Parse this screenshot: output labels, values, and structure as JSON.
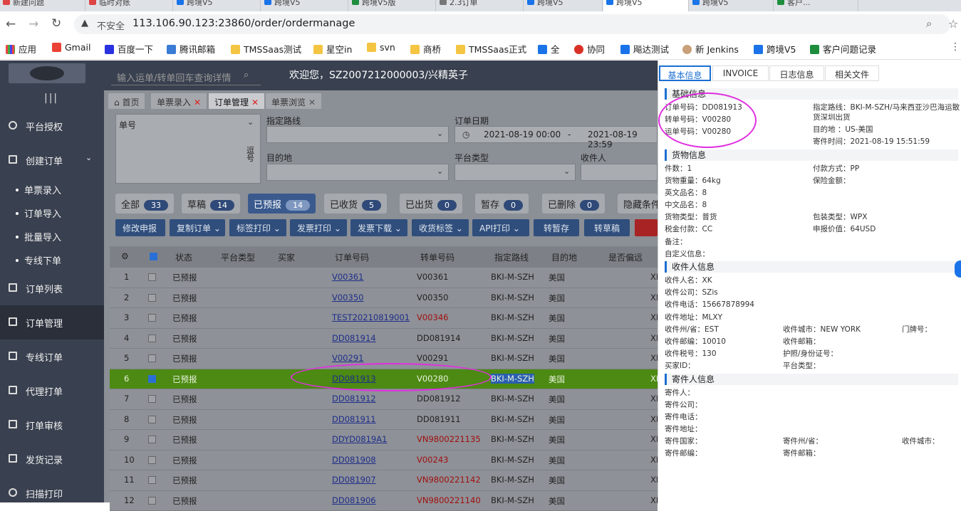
{
  "browser": {
    "tabs": [
      "新建问题",
      "临时对账",
      "跨境V5",
      "跨境V5",
      "跨境V5版",
      "2.3订单",
      "跨境V5",
      "跨境V5",
      "跨境V5",
      "客户..."
    ],
    "security": "不安全",
    "url": "113.106.90.123:23860/order/ordermanage",
    "bookmarks": [
      "应用",
      "Gmail",
      "百度一下",
      "腾讯邮箱",
      "TMSSaas测试",
      "星空in",
      "svn",
      "商桥",
      "TMSSaas正式",
      "全",
      "协同",
      "飚达测试",
      "新 Jenkins",
      "跨境V5",
      "客户问题记录"
    ]
  },
  "header": {
    "search_placeholder": "输入运单/转单回车查询详情",
    "welcome": "欢迎您，SZ2007212000003/兴精英子"
  },
  "sidebar": {
    "items": [
      {
        "label": "平台授权"
      },
      {
        "label": "创建订单"
      },
      {
        "label": "订单列表"
      },
      {
        "label": "订单管理"
      },
      {
        "label": "专线订单"
      },
      {
        "label": "代理打单"
      },
      {
        "label": "打单审核"
      },
      {
        "label": "发货记录"
      },
      {
        "label": "扫描打印"
      }
    ],
    "sub": [
      "单票录入",
      "订单导入",
      "批量导入",
      "专线下单"
    ]
  },
  "pagetabs": [
    "首页",
    "单票录入",
    "订单管理",
    "单票浏览"
  ],
  "filters": {
    "order_no": "单号",
    "wrap": "逗号",
    "route": "指定路线",
    "order_date": "订单日期",
    "date_from": "2021-08-19 00:00",
    "date_sep": "-",
    "date_to": "2021-08-19 23:59",
    "dest": "目的地",
    "platform": "平台类型",
    "receiver": "收件人"
  },
  "status_chips": [
    {
      "label": "全部",
      "count": "33"
    },
    {
      "label": "草稿",
      "count": "14"
    },
    {
      "label": "已预报",
      "count": "14"
    },
    {
      "label": "已收货",
      "count": "5"
    },
    {
      "label": "已出货",
      "count": "0"
    },
    {
      "label": "暂存",
      "count": "0"
    },
    {
      "label": "已删除",
      "count": "0"
    },
    {
      "label": "隐藏条件"
    }
  ],
  "actions": [
    "修改申报",
    "复制订单",
    "标签打印",
    "发票打印",
    "发票下载",
    "收货标签",
    "API打印",
    "转暂存",
    "转草稿"
  ],
  "grid": {
    "headers": [
      "状态",
      "平台类型",
      "买家",
      "订单号码",
      "转单号码",
      "指定路线",
      "目的地",
      "是否偏远"
    ],
    "rows": [
      {
        "n": "1",
        "status": "已预报",
        "order": "V00361",
        "transfer": "V00361",
        "route": "BKI-M-SZH",
        "dest": "美国",
        "x": "XI"
      },
      {
        "n": "2",
        "status": "已预报",
        "order": "V00350",
        "transfer": "V00350",
        "route": "BKI-M-SZH",
        "dest": "美国",
        "x": "XI"
      },
      {
        "n": "3",
        "status": "已预报",
        "order": "TEST20210819001",
        "transfer": "V00346",
        "route": "BKI-M-SZH",
        "dest": "美国",
        "x": "XI"
      },
      {
        "n": "4",
        "status": "已预报",
        "order": "DD081914",
        "transfer": "DD081914",
        "route": "BKI-M-SZH",
        "dest": "美国",
        "x": "XI"
      },
      {
        "n": "5",
        "status": "已预报",
        "order": "V00291",
        "transfer": "V00291",
        "route": "BKI-M-SZH",
        "dest": "美国",
        "x": "XI"
      },
      {
        "n": "6",
        "status": "已预报",
        "order": "DD081913",
        "transfer": "V00280",
        "route": "BKI-M-SZH",
        "dest": "美国",
        "x": "XI"
      },
      {
        "n": "7",
        "status": "已预报",
        "order": "DD081912",
        "transfer": "DD081912",
        "route": "BKI-M-SZH",
        "dest": "美国",
        "x": "XI"
      },
      {
        "n": "8",
        "status": "已预报",
        "order": "DD081911",
        "transfer": "DD081911",
        "route": "BKI-M-SZH",
        "dest": "美国",
        "x": "XI"
      },
      {
        "n": "9",
        "status": "已预报",
        "order": "DDYD0819A1",
        "transfer": "VN9800221135",
        "route": "BKI-M-SZH",
        "dest": "美国",
        "x": "XI"
      },
      {
        "n": "10",
        "status": "已预报",
        "order": "DD081908",
        "transfer": "V00243",
        "route": "BKI-M-SZH",
        "dest": "美国",
        "x": "XI"
      },
      {
        "n": "11",
        "status": "已预报",
        "order": "DD081907",
        "transfer": "VN9800221142",
        "route": "BKI-M-SZH",
        "dest": "美国",
        "x": "XI"
      },
      {
        "n": "12",
        "status": "已预报",
        "order": "DD081906",
        "transfer": "VN9800221140",
        "route": "BKI-M-SZH",
        "dest": "美国",
        "x": "XI"
      }
    ]
  },
  "detail": {
    "tabs": [
      "基本信息",
      "INVOICE",
      "日志信息",
      "相关文件"
    ],
    "sections": [
      "基础信息",
      "货物信息",
      "收件人信息",
      "寄件人信息"
    ],
    "basic": [
      "订单号码：DD081913",
      "转单号码：V00280",
      "运单号码：V00280",
      "指定路线：BKI-M-SZH/马来西亚沙巴海运散",
      "货深圳出货",
      "目的地 ：US-美国",
      "寄件时间：2021-08-19 15:51:59"
    ],
    "goods": [
      "件数：1",
      "付款方式：PP",
      "货物重量：64kg",
      "保险金额：",
      "英文品名：8",
      "中文品名：8",
      "货物类型：普货",
      "包装类型：WPX",
      "税金付款：CC",
      "申报价值：64USD",
      "备注：",
      "自定义信息："
    ],
    "receiver": [
      "收件人名：XK",
      "收件公司：SZis",
      "收件电话：15667878994",
      "收件地址：MLXY",
      "收件州/省：EST",
      "收件城市：NEW YORK",
      "门牌号：",
      "收件邮编：10010",
      "收件邮箱：",
      "收件税号：130",
      "护照/身份证号：",
      "买家ID：",
      "平台类型："
    ],
    "sender": [
      "寄件人：",
      "寄件公司：",
      "寄件电话：",
      "寄件地址：",
      "寄件国家：",
      "寄件州/省：",
      "收件城市：",
      "寄件邮编：",
      "寄件邮箱："
    ]
  }
}
